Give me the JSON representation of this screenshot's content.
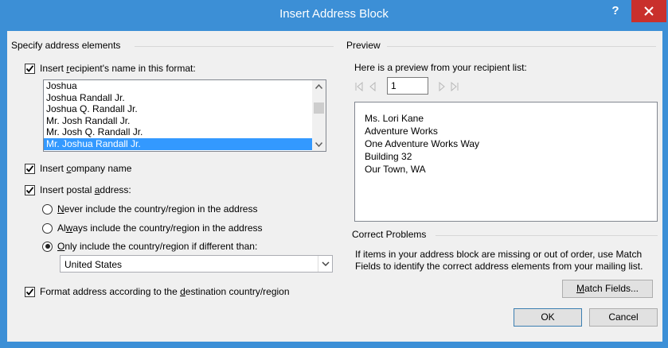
{
  "window": {
    "title": "Insert Address Block",
    "help_glyph": "?"
  },
  "left": {
    "group_label": "Specify address elements",
    "name_format": {
      "label_pre": "Insert ",
      "label_ul": "r",
      "label_post": "ecipient's name in this format:",
      "checked": true,
      "items": [
        "Joshua",
        "Joshua Randall Jr.",
        "Joshua Q. Randall Jr.",
        "Mr. Josh Randall Jr.",
        "Mr. Josh Q. Randall Jr.",
        "Mr. Joshua Randall Jr."
      ],
      "selected_index": 5
    },
    "company": {
      "label_pre": "Insert ",
      "label_ul": "c",
      "label_post": "ompany name",
      "checked": true
    },
    "postal": {
      "label_pre": "Insert postal ",
      "label_ul": "a",
      "label_post": "ddress:",
      "checked": true
    },
    "radios": [
      {
        "label_pre": "",
        "label_ul": "N",
        "label_post": "ever include the country/region in the address",
        "checked": false
      },
      {
        "label_pre": "Al",
        "label_ul": "w",
        "label_post": "ays include the country/region in the address",
        "checked": false
      },
      {
        "label_pre": "",
        "label_ul": "O",
        "label_post": "nly include the country/region if different than:",
        "checked": true
      }
    ],
    "country_value": "United States",
    "format_dest": {
      "label_pre": "Format address according to the ",
      "label_ul": "d",
      "label_post": "estination country/region",
      "checked": true
    }
  },
  "preview": {
    "group_label": "Preview",
    "intro": "Here is a preview from your recipient list:",
    "record": "1",
    "lines": [
      "Ms. Lori Kane",
      "Adventure Works",
      "One Adventure Works Way",
      "Building 32",
      "Our Town, WA"
    ]
  },
  "correct": {
    "group_label": "Correct Problems",
    "text": "If items in your address block are missing or out of order, use Match Fields to identify the correct address elements from your mailing list.",
    "match_pre": "",
    "match_ul": "M",
    "match_post": "atch Fields..."
  },
  "buttons": {
    "ok": "OK",
    "cancel": "Cancel"
  },
  "colors": {
    "titlebar": "#3c8fd6",
    "close": "#c9302c",
    "selection": "#3399ff",
    "dialog_bg": "#f0f0f0"
  }
}
